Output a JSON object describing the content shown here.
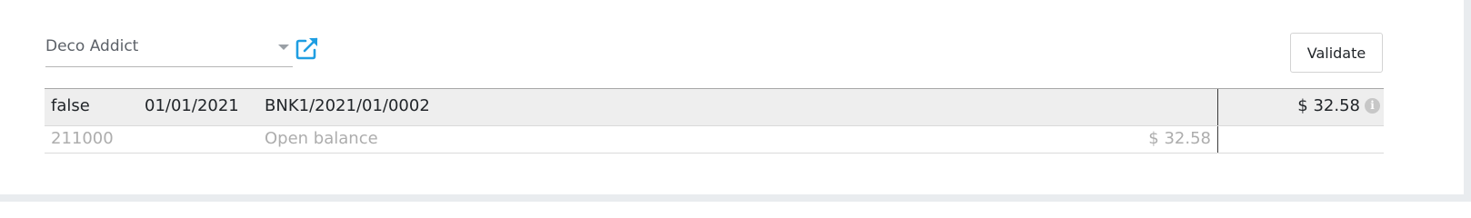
{
  "partner": {
    "value": "Deco Addict"
  },
  "toolbar": {
    "validate_label": "Validate"
  },
  "statement_line": {
    "flag": "false",
    "date": "01/01/2021",
    "reference": "BNK1/2021/01/0002",
    "amount": "$ 32.58"
  },
  "proposition": {
    "account": "211000",
    "label": "Open balance",
    "amount": "$ 32.58"
  },
  "colors": {
    "link_icon": "#1f9ee2",
    "header_row_bg": "#eeeeee",
    "muted_text": "#adadad"
  },
  "icons": {
    "external_link": "external-link-icon",
    "dropdown": "chevron-down-icon",
    "info": "info-icon"
  }
}
